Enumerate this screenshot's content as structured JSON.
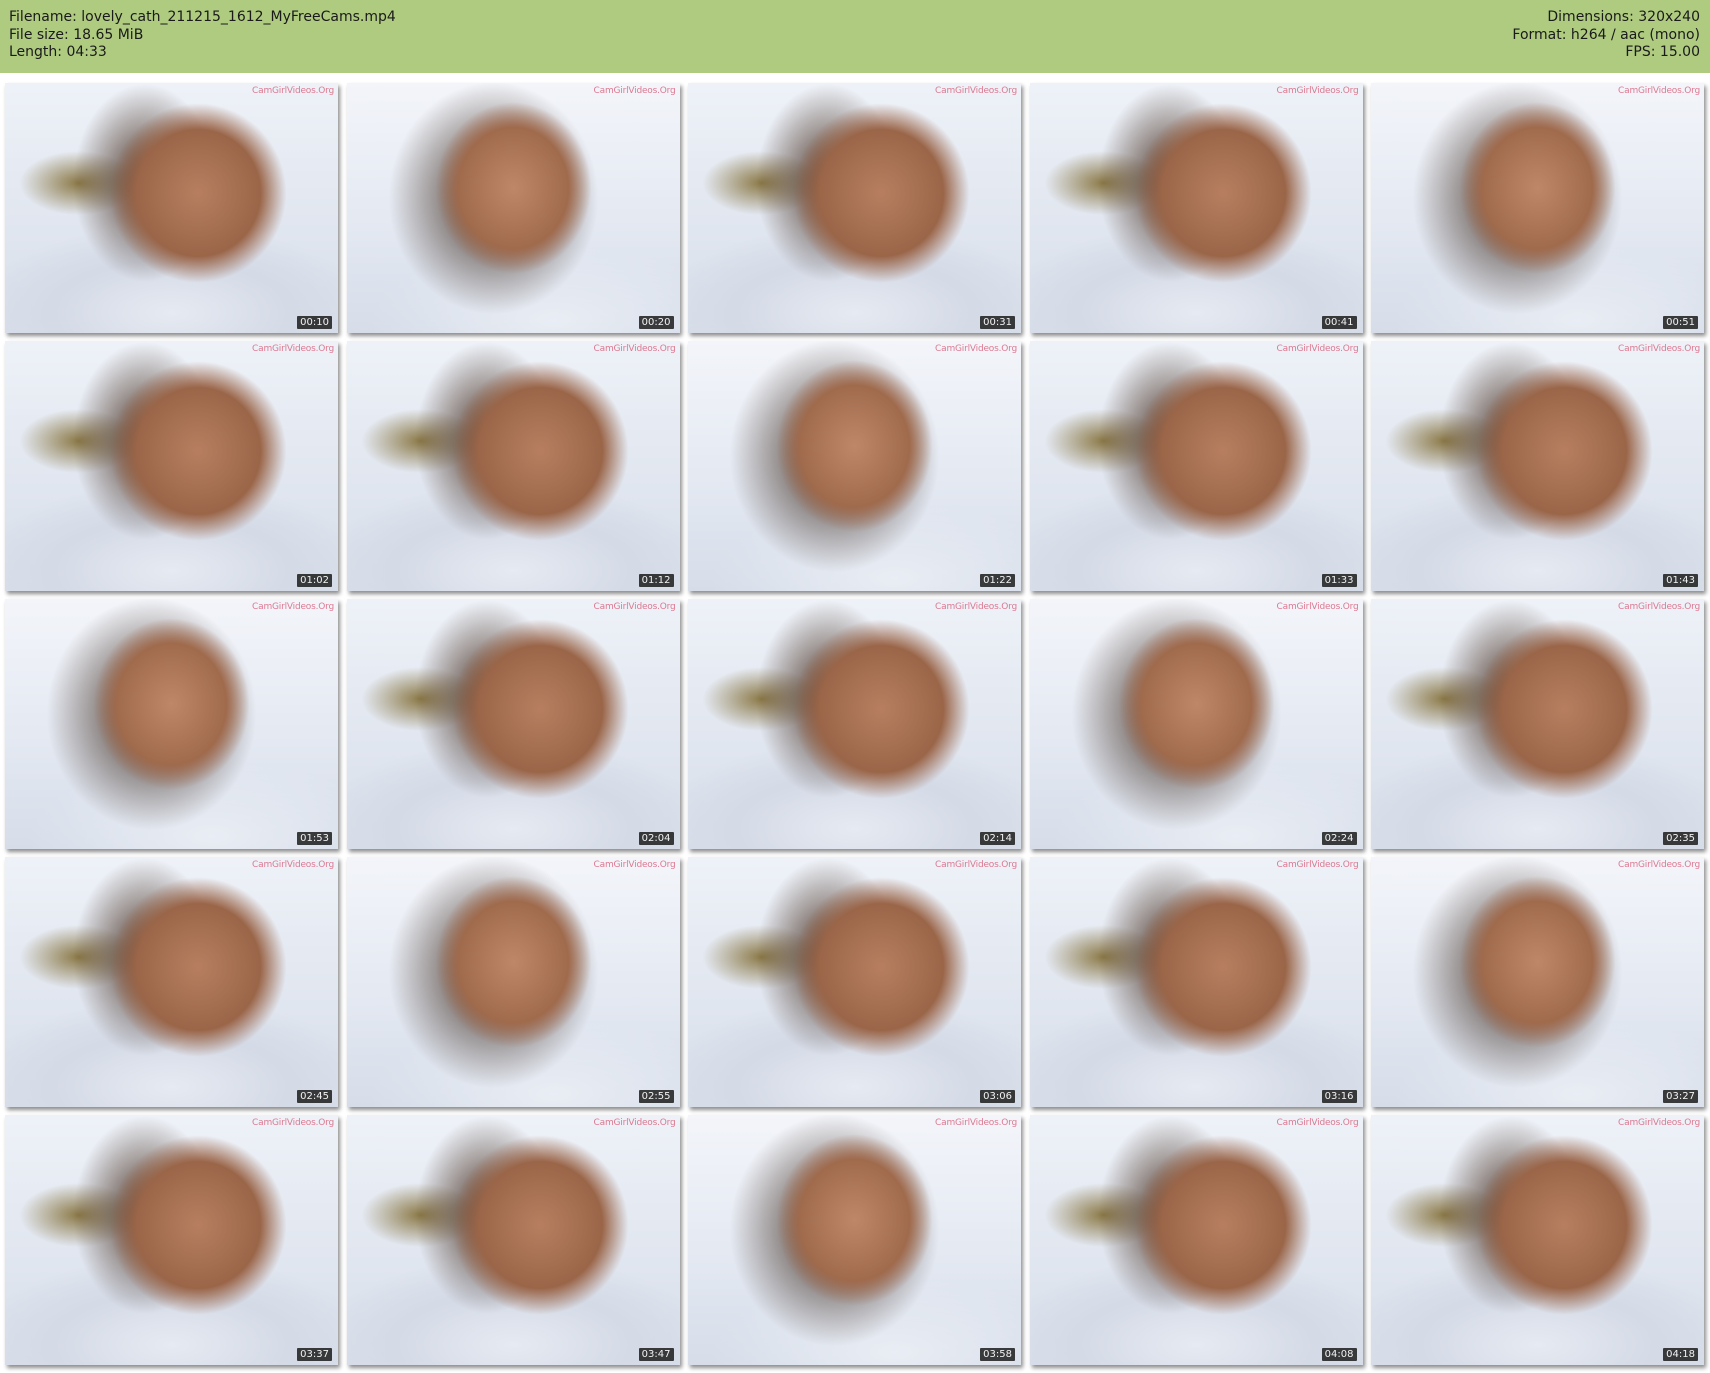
{
  "header": {
    "filename": "Filename: lovely_cath_211215_1612_MyFreeCams.mp4",
    "filesize": "File size: 18.65 MiB",
    "length": "Length: 04:33",
    "dimensions": "Dimensions: 320x240",
    "format": "Format: h264 / aac (mono)",
    "fps": "FPS: 15.00"
  },
  "thumbnails": [
    {
      "time": "00:10",
      "watermark": "CamGirlVideos.Org"
    },
    {
      "time": "00:20",
      "watermark": "CamGirlVideos.Org"
    },
    {
      "time": "00:31",
      "watermark": "CamGirlVideos.Org"
    },
    {
      "time": "00:41",
      "watermark": "CamGirlVideos.Org"
    },
    {
      "time": "00:51",
      "watermark": "CamGirlVideos.Org"
    },
    {
      "time": "01:02",
      "watermark": "CamGirlVideos.Org"
    },
    {
      "time": "01:12",
      "watermark": "CamGirlVideos.Org"
    },
    {
      "time": "01:22",
      "watermark": "CamGirlVideos.Org"
    },
    {
      "time": "01:33",
      "watermark": "CamGirlVideos.Org"
    },
    {
      "time": "01:43",
      "watermark": "CamGirlVideos.Org"
    },
    {
      "time": "01:53",
      "watermark": "CamGirlVideos.Org"
    },
    {
      "time": "02:04",
      "watermark": "CamGirlVideos.Org"
    },
    {
      "time": "02:14",
      "watermark": "CamGirlVideos.Org"
    },
    {
      "time": "02:24",
      "watermark": "CamGirlVideos.Org"
    },
    {
      "time": "02:35",
      "watermark": "CamGirlVideos.Org"
    },
    {
      "time": "02:45",
      "watermark": "CamGirlVideos.Org"
    },
    {
      "time": "02:55",
      "watermark": "CamGirlVideos.Org"
    },
    {
      "time": "03:06",
      "watermark": "CamGirlVideos.Org"
    },
    {
      "time": "03:16",
      "watermark": "CamGirlVideos.Org"
    },
    {
      "time": "03:27",
      "watermark": "CamGirlVideos.Org"
    },
    {
      "time": "03:37",
      "watermark": "CamGirlVideos.Org"
    },
    {
      "time": "03:47",
      "watermark": "CamGirlVideos.Org"
    },
    {
      "time": "03:58",
      "watermark": "CamGirlVideos.Org"
    },
    {
      "time": "04:08",
      "watermark": "CamGirlVideos.Org"
    },
    {
      "time": "04:18",
      "watermark": "CamGirlVideos.Org"
    }
  ]
}
